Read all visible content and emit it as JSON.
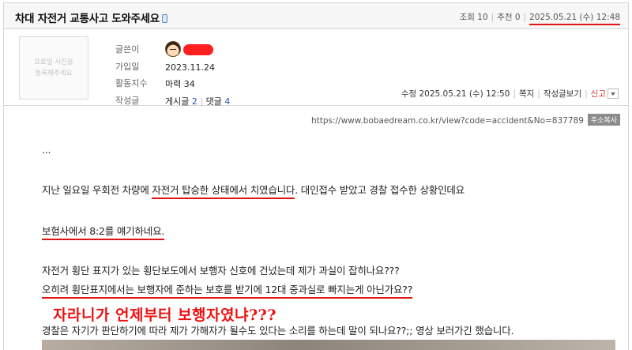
{
  "post": {
    "title": "차대 자전거 교통사고 도와주세요",
    "views_label": "조회",
    "views": "10",
    "recommend_label": "추천",
    "recommend": "0",
    "posted_at": "2025.05.21 (수) 12:48"
  },
  "profile": {
    "photo_placeholder_line1": "프로필 사진을",
    "photo_placeholder_line2": "등록해주세요",
    "labels": {
      "author": "글쓴이",
      "joined": "가입일",
      "activity": "활동지수",
      "posts": "작성글"
    },
    "joined": "2023.11.24",
    "activity_value": "마력 34",
    "posts_label": "게시글",
    "posts_count": "2",
    "comments_label": "댓글",
    "comments_count": "4"
  },
  "actions": {
    "edited_at": "수정 2025.05.21 (수) 12:50",
    "message": "쪽지",
    "view_posts": "작성글보기",
    "report": "신고"
  },
  "content": {
    "url": "https://www.bobaedream.co.kr/view?code=accident&No=837789",
    "copy_label": "주소복사",
    "ellipsis": "...",
    "p1_before": "지난 일요일 우회전 차량에 ",
    "p1_highlight": "자전거 탑승한 상태에서 치였습니다",
    "p1_after": ". 대인접수 받았고 경찰 접수한 상황인데요",
    "p2_highlight": "보험사에서 8:2를 얘기하네요.",
    "p3": "자전거 횡단 표지가 있는 횡단보도에서 보행자 신호에 건넜는데 제가 과실이 잡히나요???",
    "p4_highlight": "오히려 횡단표지에서는 보행자에 준하는 보호를 받기에 12대 중과실로 빠지는게 아닌가요??",
    "annotation": "자라니가 언제부터 보행자였냐???",
    "p5": "경찰은 자기가 판단하기에 따라 제가 가해자가 될수도 있다는 소리를 하는데 말이 되나요??;; 영상 보러가긴 했습니다."
  },
  "colors": {
    "underline": "#e21313",
    "annotation": "#ee1111",
    "count_link": "#2a55b8",
    "report": "#d93434"
  }
}
